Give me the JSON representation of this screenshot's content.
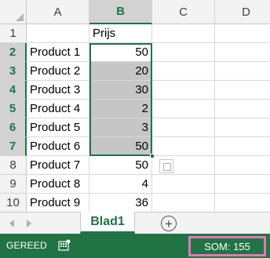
{
  "columns": [
    "A",
    "B",
    "C",
    "D"
  ],
  "selected_column": "B",
  "header_cell": "Prijs",
  "rows": [
    {
      "row": "1",
      "a": "",
      "b": "Prijs"
    },
    {
      "row": "2",
      "a": "Product 1",
      "b": "50"
    },
    {
      "row": "3",
      "a": "Product 2",
      "b": "20"
    },
    {
      "row": "4",
      "a": "Product 3",
      "b": "30"
    },
    {
      "row": "5",
      "a": "Product 4",
      "b": "2"
    },
    {
      "row": "6",
      "a": "Product 5",
      "b": "3"
    },
    {
      "row": "7",
      "a": "Product 6",
      "b": "50"
    },
    {
      "row": "8",
      "a": "Product 7",
      "b": "50"
    },
    {
      "row": "9",
      "a": "Product 8",
      "b": "4"
    },
    {
      "row": "10",
      "a": "Product 9",
      "b": "36"
    }
  ],
  "selected_range": "B2:B7",
  "sheet_tab": {
    "label": "Blad1",
    "add_icon": "plus-circle-icon"
  },
  "status": {
    "ready": "GEREED",
    "sum": "SOM: 155",
    "icon": "macro-record-icon"
  },
  "colors": {
    "accent": "#217346",
    "highlight": "#e07ab3",
    "selection_fill": "#c6c6c6"
  }
}
